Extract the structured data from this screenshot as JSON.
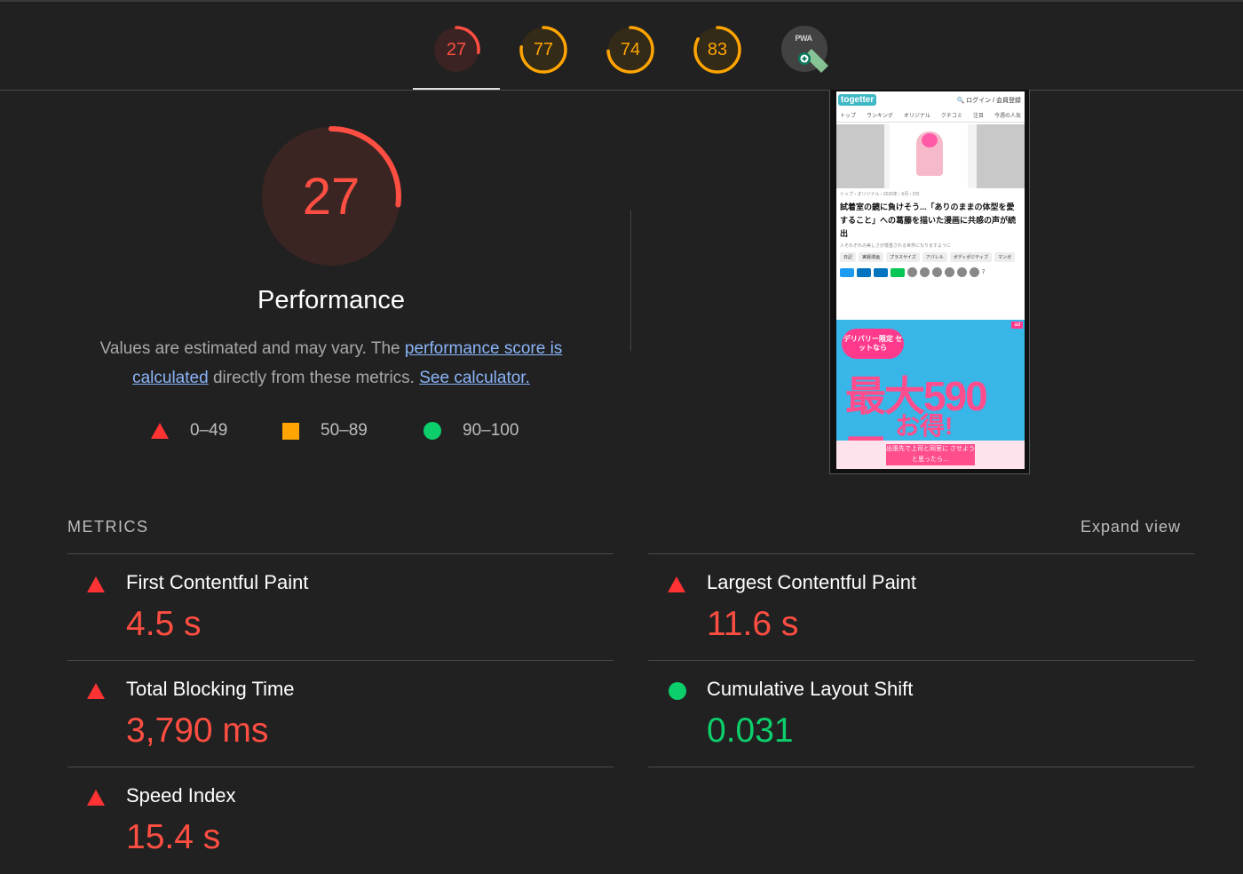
{
  "tabs": [
    {
      "score": "27",
      "color": "#ff4e42",
      "fraction": 0.27,
      "selected": true
    },
    {
      "score": "77",
      "color": "#ffa400",
      "fraction": 0.77,
      "selected": false
    },
    {
      "score": "74",
      "color": "#ffa400",
      "fraction": 0.74,
      "selected": false
    },
    {
      "score": "83",
      "color": "#ffa400",
      "fraction": 0.83,
      "selected": false
    },
    {
      "label": "PWA",
      "icon": "pwa-installable-icon",
      "selected": false
    }
  ],
  "performance": {
    "score": "27",
    "fraction": 0.27,
    "color": "#ff4e42",
    "title": "Performance",
    "desc_prefix": "Values are estimated and may vary. The ",
    "desc_link1": "performance score is calculated",
    "desc_middle": " directly from these metrics. ",
    "desc_link2": "See calculator."
  },
  "legend": [
    {
      "shape": "triangle",
      "color": "#ff3333",
      "label": "0–49"
    },
    {
      "shape": "square",
      "color": "#ffa400",
      "label": "50–89"
    },
    {
      "shape": "circle",
      "color": "#0cce6b",
      "label": "90–100"
    }
  ],
  "screenshot": {
    "logo": "togetter",
    "header_right": "ログイン / 会員登録",
    "nav": [
      "トップ",
      "ランキング",
      "オリジナル",
      "クチコミ",
      "注目",
      "今週の人気"
    ],
    "breadcrumb": "トップ › オリジナル › 2020年 › 6月 › 2日",
    "headline": "試着室の鏡に負けそう...「ありのままの体型を愛すること」への葛藤を描いた漫画に共感の声が続出",
    "subline": "人それぞれの美しさが尊重される世界になりますように",
    "tags": [
      "日記",
      "実録漫画",
      "プラスサイズ",
      "アパレル",
      "ボディポジティブ",
      "マンガ"
    ],
    "share_count": "7",
    "ad": {
      "pill": "デリバリー限定 セットなら",
      "price": "最大590円",
      "otoku": "お得!",
      "manga": "出張先で上司と同室に させようと思ったら…"
    }
  },
  "metrics_section": {
    "title": "METRICS",
    "expand": "Expand view"
  },
  "metrics": [
    {
      "name": "First Contentful Paint",
      "value": "4.5 s",
      "status": "fail"
    },
    {
      "name": "Largest Contentful Paint",
      "value": "11.6 s",
      "status": "fail"
    },
    {
      "name": "Total Blocking Time",
      "value": "3,790 ms",
      "status": "fail"
    },
    {
      "name": "Cumulative Layout Shift",
      "value": "0.031",
      "status": "pass"
    },
    {
      "name": "Speed Index",
      "value": "15.4 s",
      "status": "fail"
    }
  ]
}
